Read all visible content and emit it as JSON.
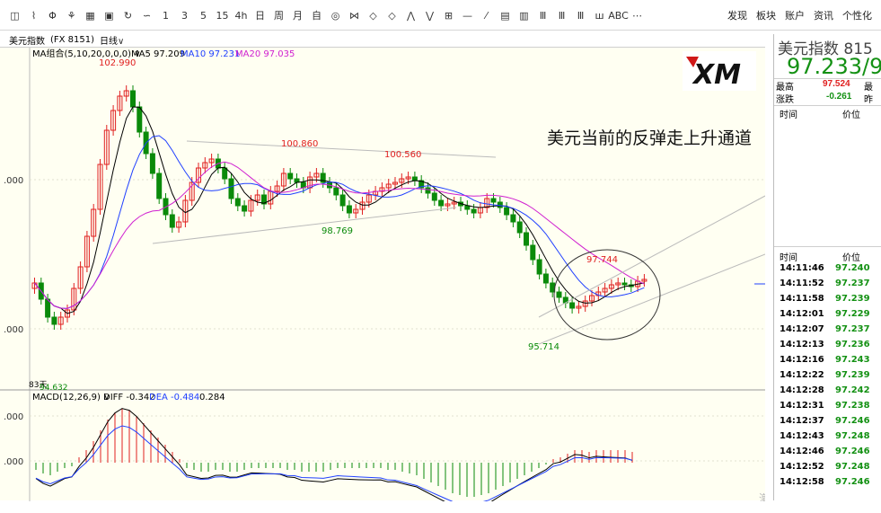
{
  "toolbar": {
    "tools": [
      "◫",
      "⌇",
      "Φ",
      "⚘",
      "▦",
      "▣",
      "↻",
      "∽",
      "1",
      "3",
      "5",
      "15",
      "4h",
      "日",
      "周",
      "月",
      "自",
      "◎",
      "⋈",
      "◇",
      "◇",
      "⋀",
      "⋁",
      "⊞",
      "—",
      "⁄",
      "▤",
      "▥",
      "Ⅲ",
      "Ⅲ",
      "Ⅲ",
      "ш",
      "ABC",
      "⋯"
    ],
    "menu": [
      "发现",
      "板块",
      "账户",
      "资讯",
      "个性化"
    ]
  },
  "title_row": {
    "name": "美元指数",
    "code": "(FX 8151)",
    "period": "日线"
  },
  "chart": {
    "ma_legend": {
      "label": "MA组合(5,10,20,0,0,0)",
      "ma5": "MA5 97.209",
      "ma10": "MA10 97.231",
      "ma20": "MA20 97.035"
    },
    "y_ticks": [
      ".000",
      ".000"
    ],
    "annotation": "美元当前的反弹走上升通道",
    "logo": "XM",
    "price_labels": [
      "102.990",
      "100.860",
      "100.560",
      "98.769",
      "97.744",
      "95.714"
    ],
    "bottom_left": "83天",
    "bottom_left_value": "94.632",
    "macd_legend": {
      "label": "MACD(12,26,9)",
      "diff": "DIFF -0.342",
      "dea": "DEA -0.484",
      "macd": "0.284"
    },
    "macd_y_ticks": [
      ".000",
      ".000",
      ".000"
    ],
    "watermark": "激活 Windows",
    "colors": {
      "up": "#e02020",
      "down": "#0a8a0a",
      "ma5": "#000000",
      "ma10": "#2040ff",
      "ma20": "#d020d0",
      "background": "#fffff2"
    }
  },
  "right_panel": {
    "name": "美元指数 815",
    "price": "97.233/9",
    "high_label": "最高",
    "high_value": "97.524",
    "high_right": "最",
    "change_label": "涨跌",
    "change_value": "-0.261",
    "change_right": "昨",
    "col_time": "时间",
    "col_price": "价位",
    "col_time2": "时间",
    "col_price2": "价位",
    "trades": [
      {
        "time": "14:11:46",
        "price": "97.240"
      },
      {
        "time": "14:11:52",
        "price": "97.237"
      },
      {
        "time": "14:11:58",
        "price": "97.239"
      },
      {
        "time": "14:12:01",
        "price": "97.229"
      },
      {
        "time": "14:12:07",
        "price": "97.237"
      },
      {
        "time": "14:12:13",
        "price": "97.236"
      },
      {
        "time": "14:12:16",
        "price": "97.243"
      },
      {
        "time": "14:12:22",
        "price": "97.239"
      },
      {
        "time": "14:12:28",
        "price": "97.242"
      },
      {
        "time": "14:12:31",
        "price": "97.238"
      },
      {
        "time": "14:12:37",
        "price": "97.246"
      },
      {
        "time": "14:12:43",
        "price": "97.248"
      },
      {
        "time": "14:12:46",
        "price": "97.246"
      },
      {
        "time": "14:12:52",
        "price": "97.248"
      },
      {
        "time": "14:12:58",
        "price": "97.246"
      }
    ]
  }
}
